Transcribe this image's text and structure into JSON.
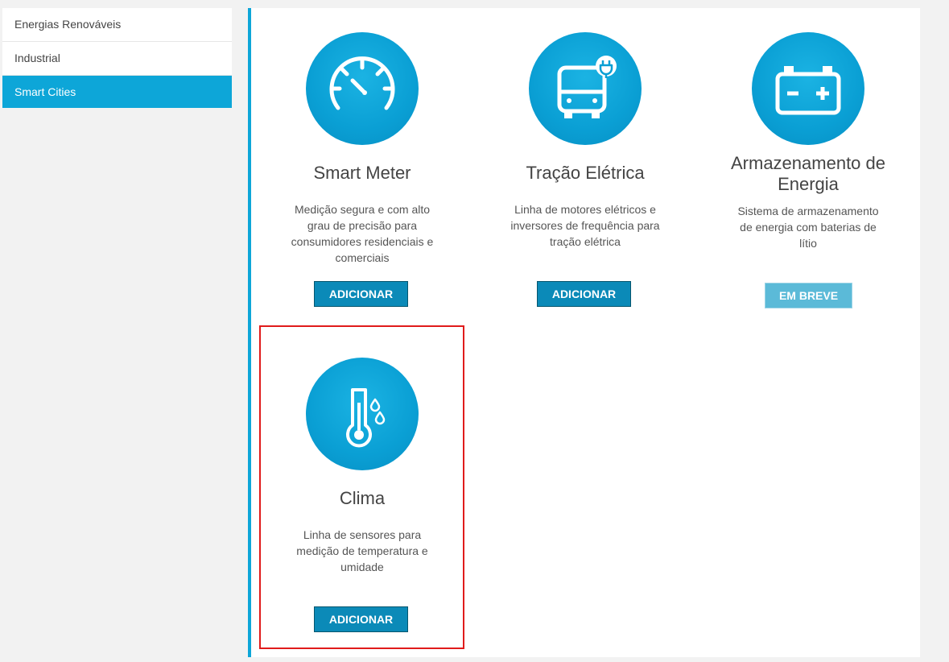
{
  "sidebar": {
    "items": [
      {
        "label": "Energias Renováveis"
      },
      {
        "label": "Industrial"
      },
      {
        "label": "Smart Cities"
      }
    ]
  },
  "cards": [
    {
      "title": "Smart Meter",
      "description": "Medição segura e com alto grau de precisão para consumidores residenciais e comerciais",
      "button": "ADICIONAR",
      "icon": "speedometer-icon"
    },
    {
      "title": "Tração Elétrica",
      "description": "Linha de motores elétricos e inversores de frequência para tração elétrica",
      "button": "ADICIONAR",
      "icon": "electric-bus-icon"
    },
    {
      "title": "Armazenamento de Energia",
      "description": "Sistema de armazenamento de energia com baterias de lítio",
      "button": "EM BREVE",
      "icon": "battery-icon"
    },
    {
      "title": "Clima",
      "description": "Linha de sensores para medição de temperatura e umidade",
      "button": "ADICIONAR",
      "icon": "thermometer-icon"
    }
  ],
  "colors": {
    "accent": "#0da6d8",
    "button": "#0b8ab8",
    "button_disabled": "#5bbad8",
    "highlight": "#e01b1b"
  }
}
